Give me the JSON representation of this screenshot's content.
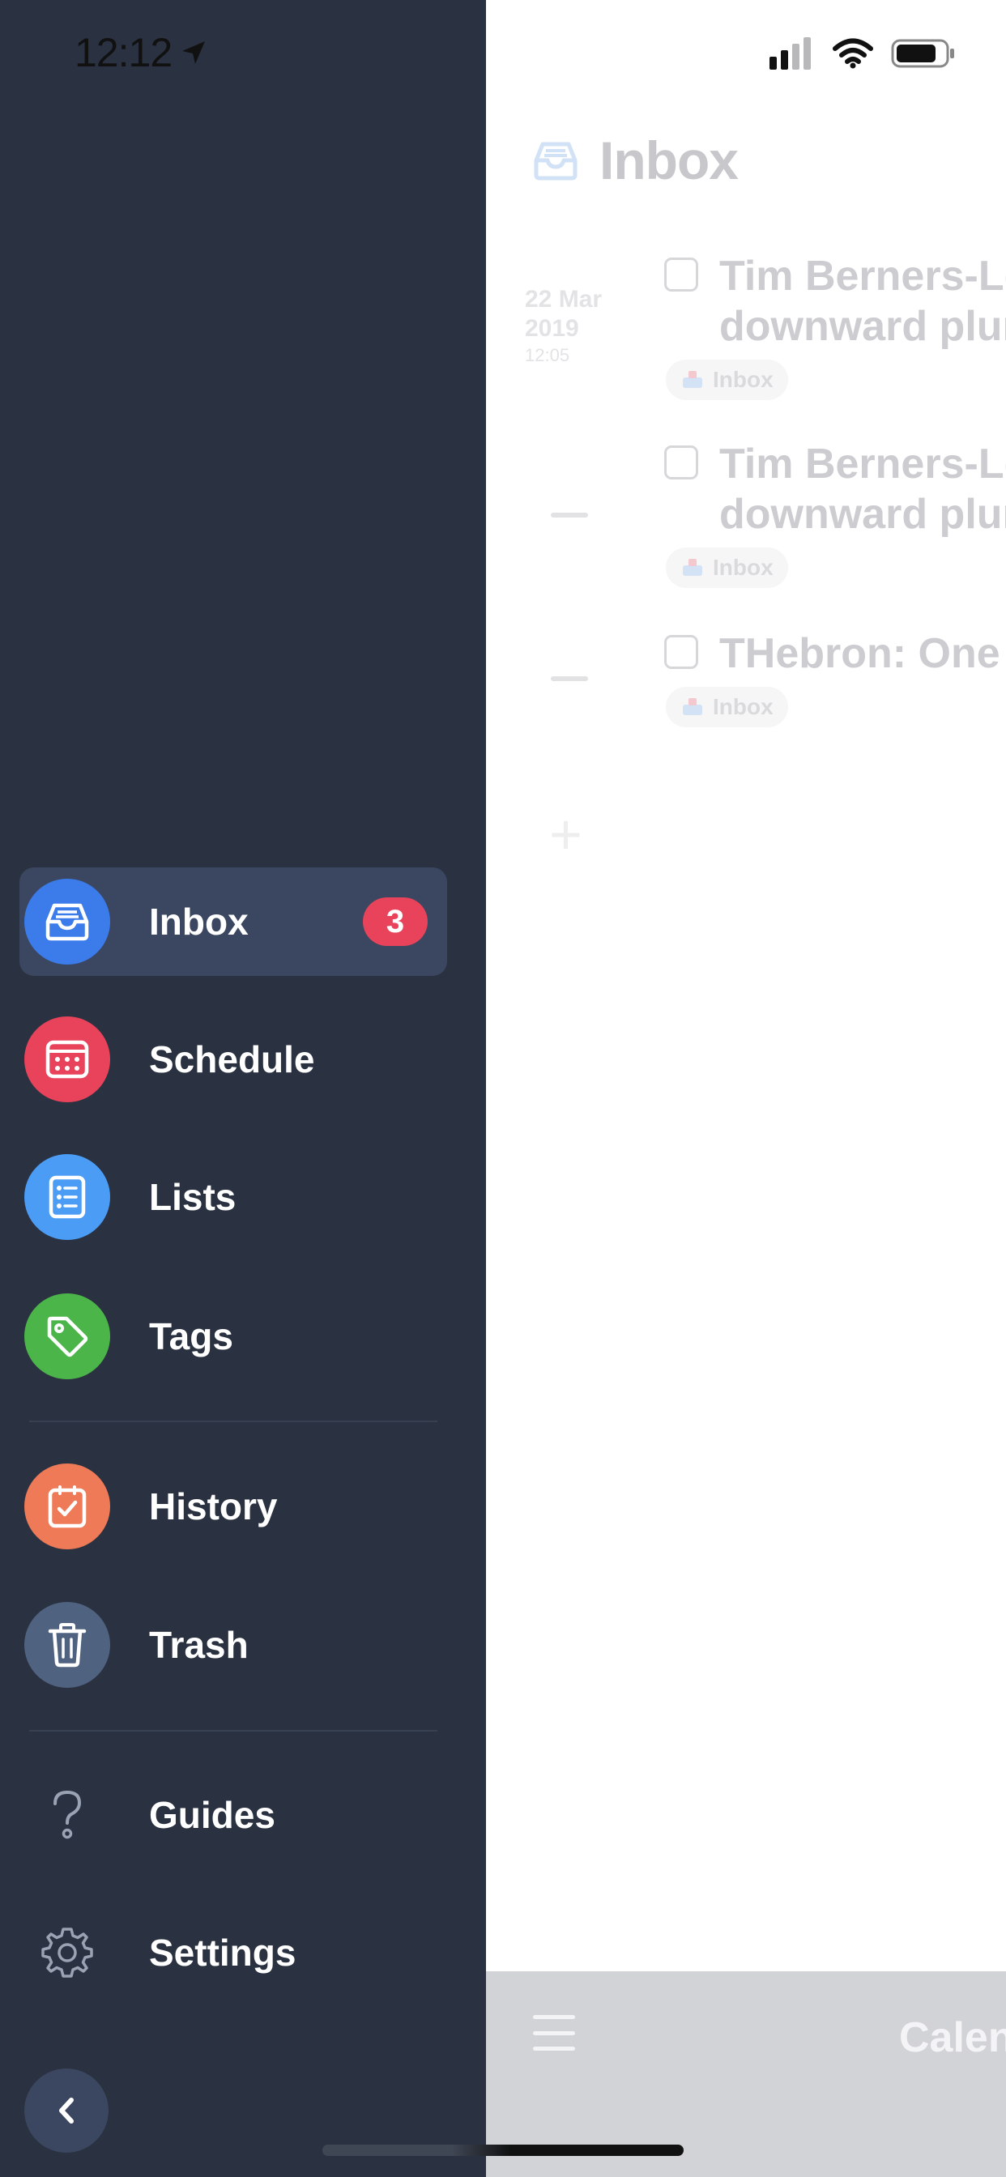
{
  "status_bar": {
    "time": "12:12",
    "location_icon": "location-arrow-icon",
    "signal_icon": "cellular-signal-icon",
    "wifi_icon": "wifi-icon",
    "battery_icon": "battery-icon"
  },
  "main": {
    "title": "Inbox",
    "title_icon": "inbox-tray-icon",
    "tasks": [
      {
        "date_line1": "22 Mar",
        "date_line2": "2019",
        "date_time": "12:05",
        "line1": "Tim Berners-Le",
        "line2": "downward plun",
        "tag": "Inbox"
      },
      {
        "line1": "Tim Berners-Le",
        "line2": "downward plun",
        "tag": "Inbox"
      },
      {
        "line1": "THebron: One S",
        "tag": "Inbox"
      }
    ],
    "add_icon": "plus-icon",
    "add_symbol": "+",
    "bottom_bar": {
      "menu_icon": "hamburger-menu-icon",
      "label": "Calen"
    }
  },
  "sidebar": {
    "items": [
      {
        "label": "Inbox",
        "icon": "inbox-tray-icon",
        "color": "#3b7bea",
        "badge": "3",
        "active": true
      },
      {
        "label": "Schedule",
        "icon": "calendar-icon",
        "color": "#e8435a"
      },
      {
        "label": "Lists",
        "icon": "list-icon",
        "color": "#4a9cf5"
      },
      {
        "label": "Tags",
        "icon": "tag-icon",
        "color": "#4bb54a"
      },
      {
        "label": "History",
        "icon": "checkbox-icon",
        "color": "#ee7a58"
      },
      {
        "label": "Trash",
        "icon": "trash-icon",
        "color": "#4f6280"
      },
      {
        "label": "Guides",
        "icon": "question-icon"
      },
      {
        "label": "Settings",
        "icon": "gear-icon"
      }
    ],
    "collapse_icon": "chevron-left-icon"
  },
  "colors": {
    "sidebar_bg": "#2a3140",
    "active_row_bg": "#3b4760",
    "badge_red": "#e8435a"
  }
}
